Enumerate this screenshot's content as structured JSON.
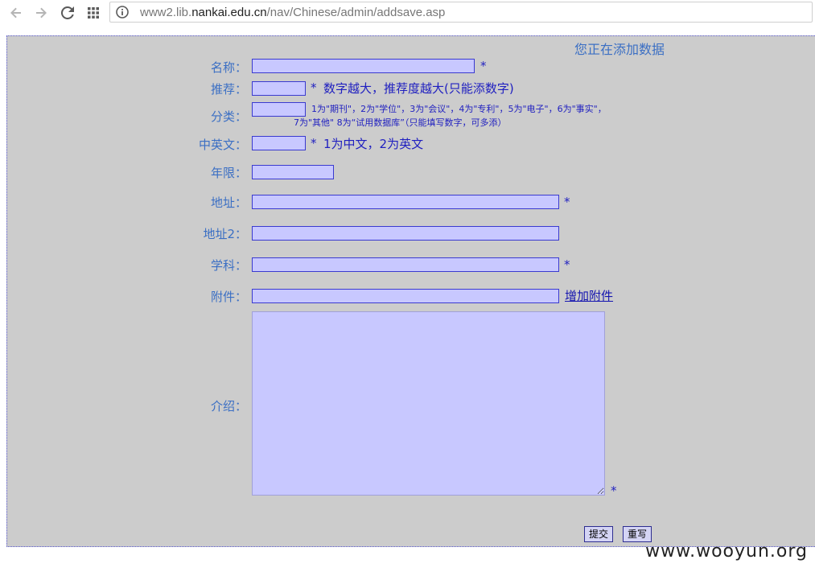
{
  "browser": {
    "url_prefix": "www2.lib.",
    "url_host": "nankai.edu.cn",
    "url_path": "/nav/Chinese/admin/addsave.asp"
  },
  "form": {
    "heading": "您正在添加数据",
    "fields": {
      "name_label": "名称：",
      "recommend_label": "推荐：",
      "recommend_hint": "数字越大，推荐度越大(只能添数字)",
      "category_label": "分类：",
      "category_hint_line1": "1为\"期刊\"，2为\"学位\"，3为\"会议\"，4为\"专利\"，5为\"电子\"，6为\"事实\"，",
      "category_hint_line2": "7为\"其他\" 8为“试用数据库”（只能填写数字，可多添）",
      "language_label": "中英文：",
      "language_hint": "1为中文，2为英文",
      "year_label": "年限：",
      "address_label": "地址：",
      "address2_label": "地址2：",
      "subject_label": "学科：",
      "attachment_label": "附件：",
      "add_attachment_link": "增加附件",
      "intro_label": "介绍："
    },
    "required_mark": "*",
    "buttons": {
      "submit": "提交",
      "reset": "重写"
    }
  },
  "watermark": "www.wooyun.org",
  "colors": {
    "page_bg": "#cccccc",
    "field_bg": "#c8c8ff",
    "label_color": "#3b6fc4",
    "hint_color": "#1f1fc0"
  }
}
